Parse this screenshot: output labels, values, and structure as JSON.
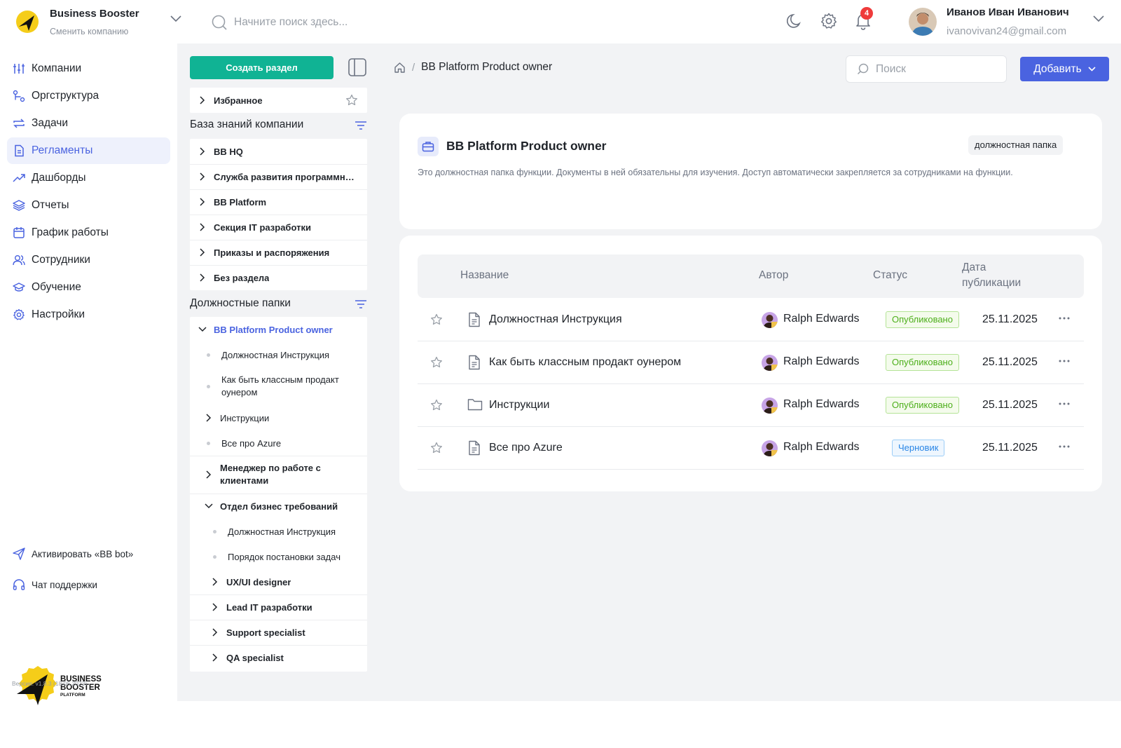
{
  "header": {
    "company_name": "Business Booster",
    "company_switch": "Сменить компанию",
    "search_placeholder": "Начните поиск здесь...",
    "notifications_count": "4",
    "user_name": "Иванов Иван Иванович",
    "user_email": "ivanovivan24@gmail.com"
  },
  "nav": {
    "items": [
      {
        "label": "Компании",
        "icon": "sliders-icon"
      },
      {
        "label": "Оргструктура",
        "icon": "org-structure-icon"
      },
      {
        "label": "Задачи",
        "icon": "repeat-icon"
      },
      {
        "label": "Регламенты",
        "icon": "document-icon",
        "active": true
      },
      {
        "label": "Дашборды",
        "icon": "trend-icon"
      },
      {
        "label": "Отчеты",
        "icon": "layers-icon"
      },
      {
        "label": "График работы",
        "icon": "calendar-icon"
      },
      {
        "label": "Сотрудники",
        "icon": "users-icon"
      },
      {
        "label": "Обучение",
        "icon": "graduation-cap-icon"
      },
      {
        "label": "Настройки",
        "icon": "gear-icon"
      }
    ],
    "activate_bot": "Активировать «BB bot»",
    "support_chat": "Чат поддержки",
    "logo_text": [
      "BUSINESS",
      "BOOSTER",
      "PLATFORM"
    ],
    "version": "Версия: v1.8.3 (18.06.2023)"
  },
  "sidebar": {
    "create_button": "Создать раздел",
    "favorites": "Избранное",
    "knowledge_title": "База знаний компании",
    "knowledge_items": [
      "BB HQ",
      "Служба развития программного обеспечения",
      "BB Platform",
      "Секция IT разработки",
      "Приказы и распоряжения",
      "Без раздела"
    ],
    "positions_title": "Должностные папки",
    "positions_tree": {
      "root": "BB Platform Product owner",
      "root_children": [
        "Должностная Инструкция",
        "Как быть классным продакт оунером",
        "Инструкции",
        "Все про Azure"
      ],
      "manager": "Менеджер по работе с клиентами",
      "dept": "Отдел бизнес требований",
      "dept_children": [
        "Должностная Инструкция",
        "Порядок постановки задач"
      ],
      "dept_folders": [
        "UX/UI designer",
        "Lead IT разработки",
        "Support specialist",
        "QA specialist"
      ]
    }
  },
  "main": {
    "breadcrumb_current": "BB Platform Product owner",
    "search_placeholder": "Поиск",
    "add_button": "Добавить",
    "folder_title": "BB Platform Product owner",
    "folder_tag": "должностная папка",
    "folder_description": "Это должностная папка функции. Документы в ней обязательны для изучения. Доступ автоматически закрепляется за сотрудниками на функции.",
    "columns": {
      "name": "Название",
      "author": "Автор",
      "status": "Статус",
      "date_line1": "Дата",
      "date_line2": "публикации"
    },
    "rows": [
      {
        "name": "Должностная Инструкция",
        "type": "file",
        "author": "Ralph Edwards",
        "status": "Опубликовано",
        "status_kind": "published",
        "date": "25.11.2025"
      },
      {
        "name": "Как быть классным продакт оунером",
        "type": "file",
        "author": "Ralph Edwards",
        "status": "Опубликовано",
        "status_kind": "published",
        "date": "25.11.2025"
      },
      {
        "name": "Инструкции",
        "type": "folder",
        "author": "Ralph Edwards",
        "status": "Опубликовано",
        "status_kind": "published",
        "date": "25.11.2025"
      },
      {
        "name": "Все про Azure",
        "type": "file",
        "author": "Ralph Edwards",
        "status": "Черновик",
        "status_kind": "draft",
        "date": "25.11.2025"
      }
    ]
  },
  "colors": {
    "accent": "#4a63e0",
    "create": "#10b394",
    "published": "#4caf1a",
    "draft": "#2a86e6",
    "badge": "#ef3b3b"
  }
}
